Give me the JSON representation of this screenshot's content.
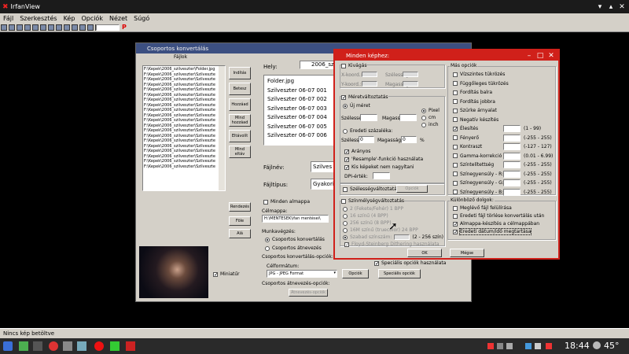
{
  "app": {
    "title": "IrfanView",
    "status": "Nincs kép betöltve",
    "zoom_box": ""
  },
  "menu": [
    "Fájl",
    "Szerkesztés",
    "Kép",
    "Opciók",
    "Nézet",
    "Súgó"
  ],
  "batch": {
    "title": "Csoportos konvertálás",
    "files_label": "Fájlok",
    "files": [
      "F:\\Kepek\\2006_szilveszter\\Folder.jpg",
      "F:\\Kepek\\2006_szilveszter\\Szilveszte",
      "F:\\Kepek\\2006_szilveszter\\Szilveszte",
      "F:\\Kepek\\2006_szilveszter\\Szilveszte",
      "F:\\Kepek\\2006_szilveszter\\Szilveszte",
      "F:\\Kepek\\2006_szilveszter\\Szilveszte",
      "F:\\Kepek\\2006_szilveszter\\Szilveszte",
      "F:\\Kepek\\2006_szilveszter\\Szilveszte",
      "F:\\Kepek\\2006_szilveszter\\Szilveszte",
      "F:\\Kepek\\2006_szilveszter\\Szilveszte",
      "F:\\Kepek\\2006_szilveszter\\Szilveszte",
      "F:\\Kepek\\2006_szilveszter\\Szilveszte",
      "F:\\Kepek\\2006_szilveszter\\Szilveszte",
      "F:\\Kepek\\2006_szilveszter\\Szilveszte",
      "F:\\Kepek\\2006_szilveszter\\Szilveszte",
      "F:\\Kepek\\2006_szilveszter\\Szilveszte",
      "F:\\Kepek\\2006_szilveszter\\Szilveszte",
      "F:\\Kepek\\2006_szilveszter\\Szilveszte",
      "F:\\Kepek\\2006_szilveszter\\Szilveszte",
      "F:\\Kepek\\2006_szilveszter\\Szilveszte"
    ],
    "buttons": {
      "start": "Indítás",
      "load": "Betesz",
      "add": "Hozzáad",
      "add_all": "Mind hozzáad",
      "remove": "Eltávolít",
      "remove_all": "Mind eltáv",
      "sort": "Rendezés",
      "up": "Föle",
      "down": "Alá"
    },
    "look_in_label": "Hely:",
    "look_in": "2006_sz",
    "browse": [
      "Folder.jpg",
      "Szilveszter 06-07 001",
      "Szilveszter 06-07 002",
      "Szilveszter 06-07 003",
      "Szilveszter 06-07 004",
      "Szilveszter 06-07 005",
      "Szilveszter 06-07 006"
    ],
    "filename_label": "Fájlnév:",
    "filename": "Szilves",
    "filetype_label": "Fájltípus:",
    "filetype": "Gyakori",
    "all_subfolders": "Minden almappa",
    "target_label": "Célmappa:",
    "target": "H:\\MENTESEK\\ifan mentései\\",
    "mode_label": "Munkavégzés:",
    "mode_convert": "Csoportos konvertálás",
    "mode_rename": "Csoportos átnevezés",
    "convert_opts_label": "Csoportos konvertálás-opciók:",
    "output_label": "Célformátum:",
    "output_format": "JPG - JPEG Format",
    "options_btn": "Opciók",
    "advanced_btn": "Speciális opciók",
    "use_advanced": "Speciális opciók használata",
    "rename_opts_label": "Csoportos átnevezés-opciók:",
    "rename_btn": "Átnevezés-opciók",
    "preview_label": "Miniatűr"
  },
  "adv": {
    "title": "Minden képhez:",
    "crop": "Kivágás",
    "x": "X-koord.:",
    "y": "Y-koord.:",
    "w": "Szélesség:",
    "h": "Magasság:",
    "resize": "Méretváltoztatás",
    "new_size": "Új méret",
    "width": "Szélesség:",
    "height": "Magasság:",
    "pixel": "Pixel",
    "cm": "cm",
    "inch": "inch",
    "percent_opt": "Eredeti százaléka:",
    "pw": "Szélesség:",
    "pw_val": "0",
    "ph": "Magasság:",
    "ph_val": "0",
    "pct": "%",
    "ratio": "Arányos",
    "resample": "'Resample'-funkció használata",
    "no_enlarge": "Kis képeket nem nagyítani",
    "dpi": "DPI-érték:",
    "canvas": "Szélességváltoztatás",
    "canvas_btn": "Opciók",
    "colors": "Színmélységváltoztatás",
    "c1": "2 (Fekete/Fehér) 1 BPP",
    "c2": "16 színű (4 BPP)",
    "c3": "256 színű (8 BPP)",
    "c4": "16M színű (truecolor) 24 BPP",
    "c5": "Szabad színszám:",
    "c5_range": "(2 - 256 szín)",
    "dither": "Floyd-Steinberg Dithering használata",
    "misc": "Más opciók",
    "m1": "Vízszintes tükrözés",
    "m2": "Függőleges tükrözés",
    "m3": "Fordítás balra",
    "m4": "Fordítás jobbra",
    "m5": "Szürke árnyalat",
    "m6": "Negatív készítés",
    "m7": "Élesítés",
    "m7_r": "(1 - 99)",
    "m8": "Fényerő",
    "m8_r": "(-255 - 255)",
    "m9": "Kontraszt",
    "m9_r": "(-127 - 127)",
    "m10": "Gamma-korrekció",
    "m10_r": "(0.01 - 6.99)",
    "m11": "Színtelítettség",
    "m11_r": "(-255 - 255)",
    "m12": "Színegyensúly - R:",
    "m12_r": "(-255 - 255)",
    "m13": "Színegyensúly - G:",
    "m13_r": "(-255 - 255)",
    "m14": "Színegyensúly - B:",
    "m14_r": "(-255 - 255)",
    "other": "Különböző dolgok:",
    "o1": "Meglévő fájl felülírása",
    "o2": "Eredeti fájl törlése konvertálás után",
    "o3": "Almappa-készítés a célmappában",
    "o4": "Eredeti dátum/idő megtartása",
    "ok": "OK",
    "cancel": "Mégse"
  },
  "taskbar": {
    "time": "18:44",
    "temp": "45°"
  }
}
